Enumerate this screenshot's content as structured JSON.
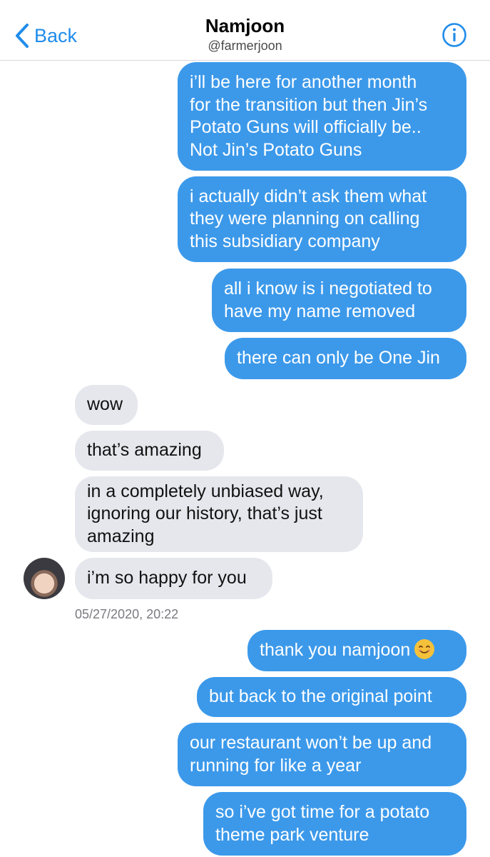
{
  "header": {
    "back_label": "Back",
    "title": "Namjoon",
    "handle": "@farmerjoon"
  },
  "messages": [
    {
      "dir": "out",
      "lines": [
        "i’ll be here for another month",
        "for the transition but then Jin’s",
        "Potato Guns will officially be..",
        "Not Jin’s Potato Guns"
      ]
    },
    {
      "dir": "out",
      "lines": [
        "i actually didn’t ask them what",
        "they were planning on calling",
        "this subsidiary company"
      ]
    },
    {
      "dir": "out",
      "lines": [
        "all i know is i negotiated to",
        "have my name removed"
      ]
    },
    {
      "dir": "out",
      "lines": [
        "there can only be One Jin"
      ]
    },
    {
      "dir": "in",
      "lines": [
        "wow"
      ]
    },
    {
      "dir": "in",
      "lines": [
        "that’s amazing"
      ]
    },
    {
      "dir": "in",
      "lines": [
        "in a completely unbiased way,",
        "ignoring our history, that’s just",
        "amazing"
      ]
    },
    {
      "dir": "in",
      "lines": [
        "i’m so happy for you"
      ]
    },
    {
      "dir": "out",
      "lines": [
        "thank you namjoon"
      ],
      "emoji": "smiling-face-emoji"
    },
    {
      "dir": "out",
      "lines": [
        "but back to the original point"
      ]
    },
    {
      "dir": "out",
      "lines": [
        "our restaurant won’t be up and",
        "running for like a year"
      ]
    },
    {
      "dir": "out",
      "lines": [
        "so i’ve got time for a potato",
        "theme park venture"
      ]
    }
  ],
  "timestamp": "05/27/2020, 20:22",
  "colors": {
    "accent": "#1f8ceb",
    "outgoing_bubble": "#3c99ea",
    "incoming_bubble": "#e6e7ed"
  },
  "icons": {
    "back": "chevron-left-icon",
    "info": "info-circle-icon"
  }
}
